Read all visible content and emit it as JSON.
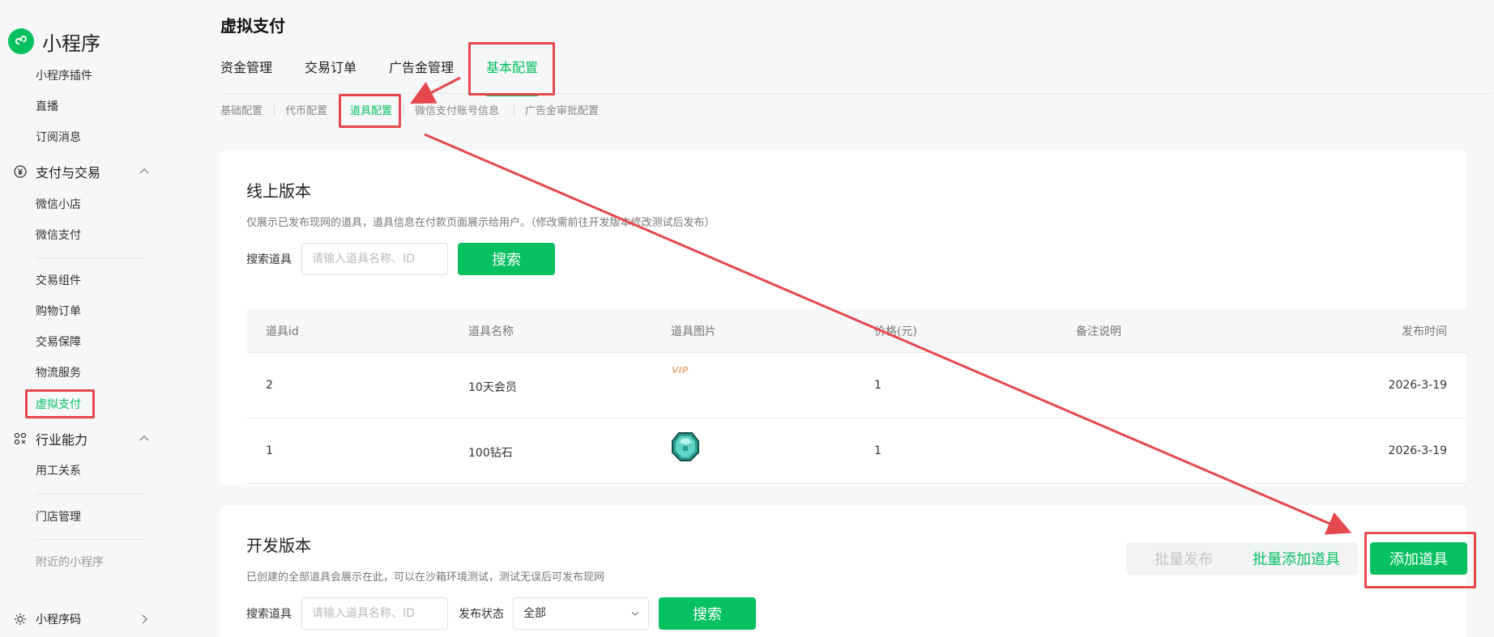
{
  "brand": {
    "title": "小程序"
  },
  "sidebar": {
    "items_top": [
      "小程序插件",
      "直播",
      "订阅消息"
    ],
    "group_payment": "支付与交易",
    "payment_items_a": [
      "微信小店",
      "微信支付"
    ],
    "payment_items_b": [
      "交易组件",
      "购物订单",
      "交易保障",
      "物流服务",
      "虚拟支付"
    ],
    "group_industry": "行业能力",
    "industry_items_a": [
      "用工关系"
    ],
    "industry_items_b": [
      "门店管理"
    ],
    "nearby": "附近的小程序",
    "group_qrcode": "小程序码"
  },
  "header": {
    "title": "虚拟支付",
    "tabs": [
      "资金管理",
      "交易订单",
      "广告金管理",
      "基本配置"
    ],
    "subtabs": [
      "基础配置",
      "代币配置",
      "道具配置",
      "微信支付账号信息",
      "广告金审批配置"
    ]
  },
  "online": {
    "title": "线上版本",
    "desc": "仅展示已发布现网的道具，道具信息在付款页面展示给用户。（修改需前往开发版本修改测试后发布）",
    "search_label": "搜索道具",
    "search_placeholder": "请输入道具名称、ID",
    "search_button": "搜索",
    "columns": [
      "道具id",
      "道具名称",
      "道具图片",
      "价格(元)",
      "备注说明",
      "发布时间"
    ],
    "rows": [
      {
        "id": "2",
        "name": "10天会员",
        "image": "vip-icon",
        "price": "1",
        "note": "",
        "time": "2026-3-19"
      },
      {
        "id": "1",
        "name": "100钻石",
        "image": "diamond-icon",
        "price": "1",
        "note": "",
        "time": "2026-3-19"
      }
    ],
    "vip_text": "VIP"
  },
  "dev": {
    "title": "开发版本",
    "desc": "已创建的全部道具会展示在此，可以在沙箱环境测试，测试无误后可发布现网",
    "batch_publish": "批量发布",
    "batch_add": "批量添加道具",
    "add_item": "添加道具",
    "search_label": "搜索道具",
    "search_placeholder": "请输入道具名称、ID",
    "status_label": "发布状态",
    "status_value": "全部",
    "search_button": "搜索"
  },
  "colors": {
    "accent": "#07c160",
    "annotation": "#e5484d"
  }
}
